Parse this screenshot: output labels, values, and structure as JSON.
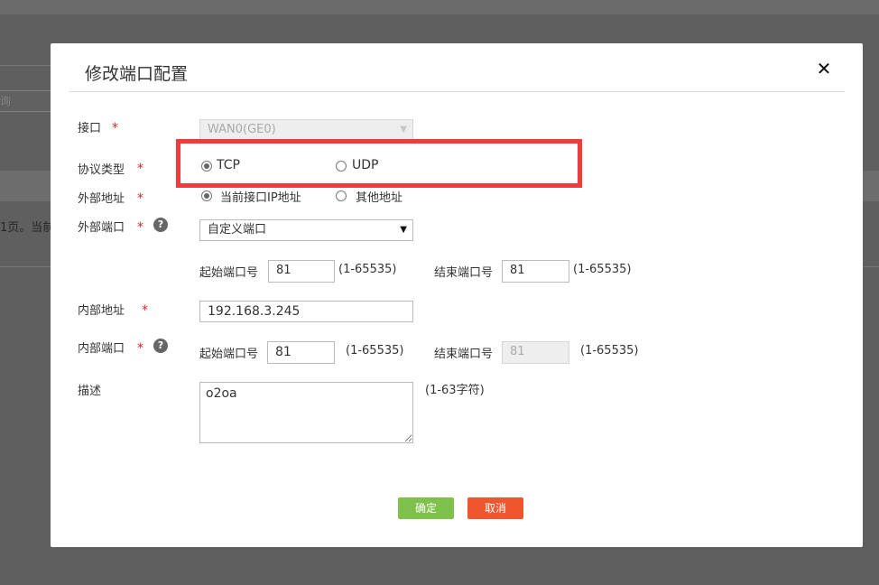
{
  "background": {
    "search_placeholder": "询",
    "pager_text": "1页。当前"
  },
  "modal": {
    "title": "修改端口配置",
    "close_symbol": "✕"
  },
  "form": {
    "required_mark": "*",
    "interface": {
      "label": "接口",
      "value": "WAN0(GE0)"
    },
    "protocol": {
      "label": "协议类型",
      "options": [
        {
          "label": "TCP",
          "checked": true
        },
        {
          "label": "UDP",
          "checked": false
        }
      ]
    },
    "external_address": {
      "label": "外部地址",
      "options": [
        {
          "label": "当前接口IP地址",
          "checked": true
        },
        {
          "label": "其他地址",
          "checked": false
        }
      ]
    },
    "external_port": {
      "label": "外部端口",
      "help": "?",
      "mode": "自定义端口",
      "start_label": "起始端口号",
      "start_value": "81",
      "start_range": "(1-65535)",
      "end_label": "结束端口号",
      "end_value": "81",
      "end_range": "(1-65535)"
    },
    "internal_address": {
      "label": "内部地址",
      "value": "192.168.3.245"
    },
    "internal_port": {
      "label": "内部端口",
      "help": "?",
      "start_label": "起始端口号",
      "start_value": "81",
      "start_range": "(1-65535)",
      "end_label": "结束端口号",
      "end_value": "81",
      "end_range": "(1-65535)"
    },
    "description": {
      "label": "描述",
      "value": "o2oa",
      "hint": "(1-63字符)"
    }
  },
  "buttons": {
    "ok": "确定",
    "cancel": "取消"
  },
  "colors": {
    "required": "#e52222",
    "highlight": "#ef3b3b",
    "ok": "#7fc24b",
    "cancel": "#f0562e"
  }
}
